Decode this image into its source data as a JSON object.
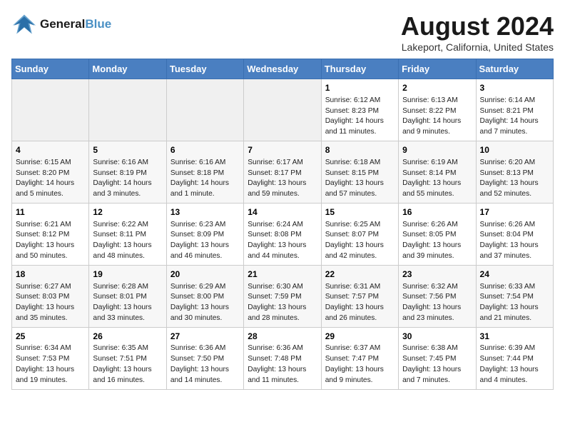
{
  "logo": {
    "line1": "General",
    "line2": "Blue"
  },
  "title": "August 2024",
  "location": "Lakeport, California, United States",
  "days_header": [
    "Sunday",
    "Monday",
    "Tuesday",
    "Wednesday",
    "Thursday",
    "Friday",
    "Saturday"
  ],
  "weeks": [
    [
      {
        "num": "",
        "info": "",
        "empty": true
      },
      {
        "num": "",
        "info": "",
        "empty": true
      },
      {
        "num": "",
        "info": "",
        "empty": true
      },
      {
        "num": "",
        "info": "",
        "empty": true
      },
      {
        "num": "1",
        "info": "Sunrise: 6:12 AM\nSunset: 8:23 PM\nDaylight: 14 hours\nand 11 minutes.",
        "empty": false
      },
      {
        "num": "2",
        "info": "Sunrise: 6:13 AM\nSunset: 8:22 PM\nDaylight: 14 hours\nand 9 minutes.",
        "empty": false
      },
      {
        "num": "3",
        "info": "Sunrise: 6:14 AM\nSunset: 8:21 PM\nDaylight: 14 hours\nand 7 minutes.",
        "empty": false
      }
    ],
    [
      {
        "num": "4",
        "info": "Sunrise: 6:15 AM\nSunset: 8:20 PM\nDaylight: 14 hours\nand 5 minutes.",
        "empty": false
      },
      {
        "num": "5",
        "info": "Sunrise: 6:16 AM\nSunset: 8:19 PM\nDaylight: 14 hours\nand 3 minutes.",
        "empty": false
      },
      {
        "num": "6",
        "info": "Sunrise: 6:16 AM\nSunset: 8:18 PM\nDaylight: 14 hours\nand 1 minute.",
        "empty": false
      },
      {
        "num": "7",
        "info": "Sunrise: 6:17 AM\nSunset: 8:17 PM\nDaylight: 13 hours\nand 59 minutes.",
        "empty": false
      },
      {
        "num": "8",
        "info": "Sunrise: 6:18 AM\nSunset: 8:15 PM\nDaylight: 13 hours\nand 57 minutes.",
        "empty": false
      },
      {
        "num": "9",
        "info": "Sunrise: 6:19 AM\nSunset: 8:14 PM\nDaylight: 13 hours\nand 55 minutes.",
        "empty": false
      },
      {
        "num": "10",
        "info": "Sunrise: 6:20 AM\nSunset: 8:13 PM\nDaylight: 13 hours\nand 52 minutes.",
        "empty": false
      }
    ],
    [
      {
        "num": "11",
        "info": "Sunrise: 6:21 AM\nSunset: 8:12 PM\nDaylight: 13 hours\nand 50 minutes.",
        "empty": false
      },
      {
        "num": "12",
        "info": "Sunrise: 6:22 AM\nSunset: 8:11 PM\nDaylight: 13 hours\nand 48 minutes.",
        "empty": false
      },
      {
        "num": "13",
        "info": "Sunrise: 6:23 AM\nSunset: 8:09 PM\nDaylight: 13 hours\nand 46 minutes.",
        "empty": false
      },
      {
        "num": "14",
        "info": "Sunrise: 6:24 AM\nSunset: 8:08 PM\nDaylight: 13 hours\nand 44 minutes.",
        "empty": false
      },
      {
        "num": "15",
        "info": "Sunrise: 6:25 AM\nSunset: 8:07 PM\nDaylight: 13 hours\nand 42 minutes.",
        "empty": false
      },
      {
        "num": "16",
        "info": "Sunrise: 6:26 AM\nSunset: 8:05 PM\nDaylight: 13 hours\nand 39 minutes.",
        "empty": false
      },
      {
        "num": "17",
        "info": "Sunrise: 6:26 AM\nSunset: 8:04 PM\nDaylight: 13 hours\nand 37 minutes.",
        "empty": false
      }
    ],
    [
      {
        "num": "18",
        "info": "Sunrise: 6:27 AM\nSunset: 8:03 PM\nDaylight: 13 hours\nand 35 minutes.",
        "empty": false
      },
      {
        "num": "19",
        "info": "Sunrise: 6:28 AM\nSunset: 8:01 PM\nDaylight: 13 hours\nand 33 minutes.",
        "empty": false
      },
      {
        "num": "20",
        "info": "Sunrise: 6:29 AM\nSunset: 8:00 PM\nDaylight: 13 hours\nand 30 minutes.",
        "empty": false
      },
      {
        "num": "21",
        "info": "Sunrise: 6:30 AM\nSunset: 7:59 PM\nDaylight: 13 hours\nand 28 minutes.",
        "empty": false
      },
      {
        "num": "22",
        "info": "Sunrise: 6:31 AM\nSunset: 7:57 PM\nDaylight: 13 hours\nand 26 minutes.",
        "empty": false
      },
      {
        "num": "23",
        "info": "Sunrise: 6:32 AM\nSunset: 7:56 PM\nDaylight: 13 hours\nand 23 minutes.",
        "empty": false
      },
      {
        "num": "24",
        "info": "Sunrise: 6:33 AM\nSunset: 7:54 PM\nDaylight: 13 hours\nand 21 minutes.",
        "empty": false
      }
    ],
    [
      {
        "num": "25",
        "info": "Sunrise: 6:34 AM\nSunset: 7:53 PM\nDaylight: 13 hours\nand 19 minutes.",
        "empty": false
      },
      {
        "num": "26",
        "info": "Sunrise: 6:35 AM\nSunset: 7:51 PM\nDaylight: 13 hours\nand 16 minutes.",
        "empty": false
      },
      {
        "num": "27",
        "info": "Sunrise: 6:36 AM\nSunset: 7:50 PM\nDaylight: 13 hours\nand 14 minutes.",
        "empty": false
      },
      {
        "num": "28",
        "info": "Sunrise: 6:36 AM\nSunset: 7:48 PM\nDaylight: 13 hours\nand 11 minutes.",
        "empty": false
      },
      {
        "num": "29",
        "info": "Sunrise: 6:37 AM\nSunset: 7:47 PM\nDaylight: 13 hours\nand 9 minutes.",
        "empty": false
      },
      {
        "num": "30",
        "info": "Sunrise: 6:38 AM\nSunset: 7:45 PM\nDaylight: 13 hours\nand 7 minutes.",
        "empty": false
      },
      {
        "num": "31",
        "info": "Sunrise: 6:39 AM\nSunset: 7:44 PM\nDaylight: 13 hours\nand 4 minutes.",
        "empty": false
      }
    ]
  ]
}
